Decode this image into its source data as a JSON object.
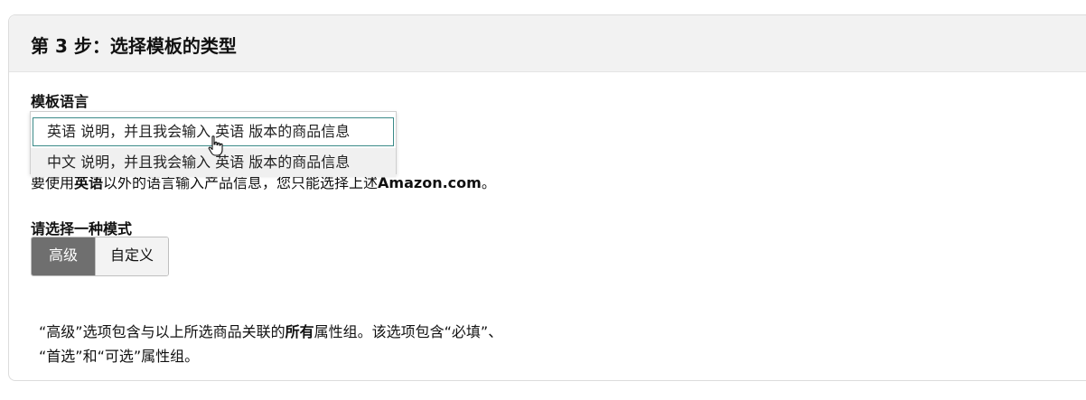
{
  "step_title": "第 3 步：选择模板的类型",
  "language_section": {
    "label": "模板语言",
    "options": [
      "英语 说明，并且我会输入 英语 版本的商品信息",
      "中文 说明，并且我会输入 英语 版本的商品信息"
    ],
    "highlighted_index": 0,
    "partially_hidden_note": {
      "prefix": "要使用",
      "bold_word": "英语",
      "middle": "以外的语言输入产品信息，您只能选择上述",
      "brand": "Amazon.com",
      "suffix": "。"
    }
  },
  "mode_section": {
    "label": "请选择一种模式",
    "buttons": [
      "高级",
      "自定义"
    ],
    "selected": "高级"
  },
  "description": {
    "line1_part1": "“高级”选项包含与以上所选商品关联的",
    "line1_bold": "所有",
    "line1_part2": "属性组。该选项包含“必填”、",
    "line2": "“首选”和“可选”属性组。"
  },
  "colors": {
    "header_bg": "#f2f2f2",
    "active_button_bg": "#6f6f6f",
    "highlight_border": "#3a8a88"
  },
  "icons": [
    "hand-pointer-cursor-icon"
  ]
}
